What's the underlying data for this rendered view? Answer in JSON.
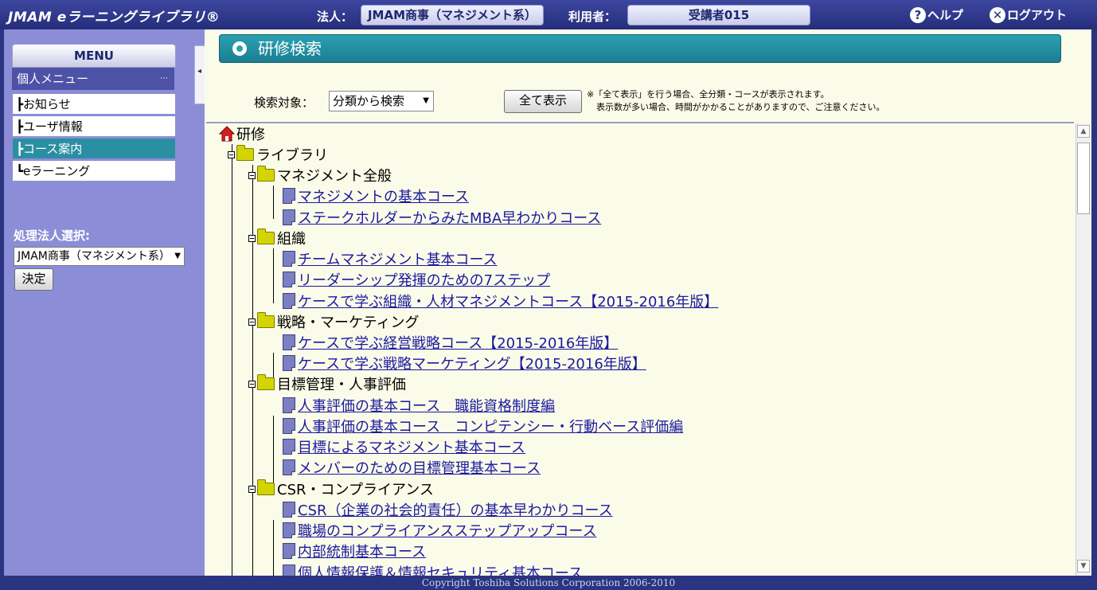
{
  "header": {
    "brand": "JMAM eラーニングライブラリ®",
    "corp_label": "法人：",
    "corp_value": "JMAM商事（マネジメント系）",
    "user_label": "利用者：",
    "user_value": "受講者015",
    "help_label": "ヘルプ",
    "logout_label": "ログアウト"
  },
  "sidebar": {
    "menu_title": "MENU",
    "section_title": "個人メニュー",
    "items": [
      {
        "label": "お知らせ"
      },
      {
        "label": "ユーザ情報"
      },
      {
        "label": "コース案内"
      },
      {
        "label": "eラーニング"
      }
    ],
    "corp_select_label": "処理法人選択:",
    "corp_select_value": "JMAM商事（マネジメント系）",
    "decide_label": "決定"
  },
  "page": {
    "title": "研修検索",
    "search_label": "検索対象：",
    "search_value": "分類から検索",
    "show_all_label": "全て表示",
    "note_line1": "※「全て表示」を行う場合、全分類・コースが表示されます。",
    "note_line2": "表示数が多い場合、時間がかかることがありますので、ご注意ください。"
  },
  "tree": {
    "root": "研修",
    "library": "ライブラリ",
    "categories": [
      {
        "name": "マネジメント全般",
        "courses": [
          "マネジメントの基本コース",
          "ステークホルダーからみたMBA早わかりコース"
        ]
      },
      {
        "name": "組織",
        "courses": [
          "チームマネジメント基本コース",
          "リーダーシップ発揮のための7ステップ",
          "ケースで学ぶ組織・人材マネジメントコース【2015-2016年版】"
        ]
      },
      {
        "name": "戦略・マーケティング",
        "courses": [
          "ケースで学ぶ経営戦略コース【2015-2016年版】",
          "ケースで学ぶ戦略マーケティング【2015-2016年版】"
        ]
      },
      {
        "name": "目標管理・人事評価",
        "courses": [
          "人事評価の基本コース　職能資格制度編",
          "人事評価の基本コース　コンピテンシー・行動ベース評価編",
          "目標によるマネジメント基本コース",
          "メンバーのための目標管理基本コース"
        ]
      },
      {
        "name": "CSR・コンプライアンス",
        "courses": [
          "CSR（企業の社会的責任）の基本早わかりコース",
          "職場のコンプライアンスステップアップコース",
          "内部統制基本コース",
          "個人情報保護＆情報セキュリティ基本コース"
        ]
      }
    ]
  },
  "footer": {
    "copyright": "Copyright Toshiba Solutions Corporation 2006-2010"
  },
  "colors": {
    "header_bg": "#2b3480",
    "sidebar_bg": "#8b8ed6",
    "content_bg": "#fbfbe9",
    "accent": "#2aa0b3",
    "link": "#1a1aa0",
    "active_item": "#2b8fa3"
  }
}
